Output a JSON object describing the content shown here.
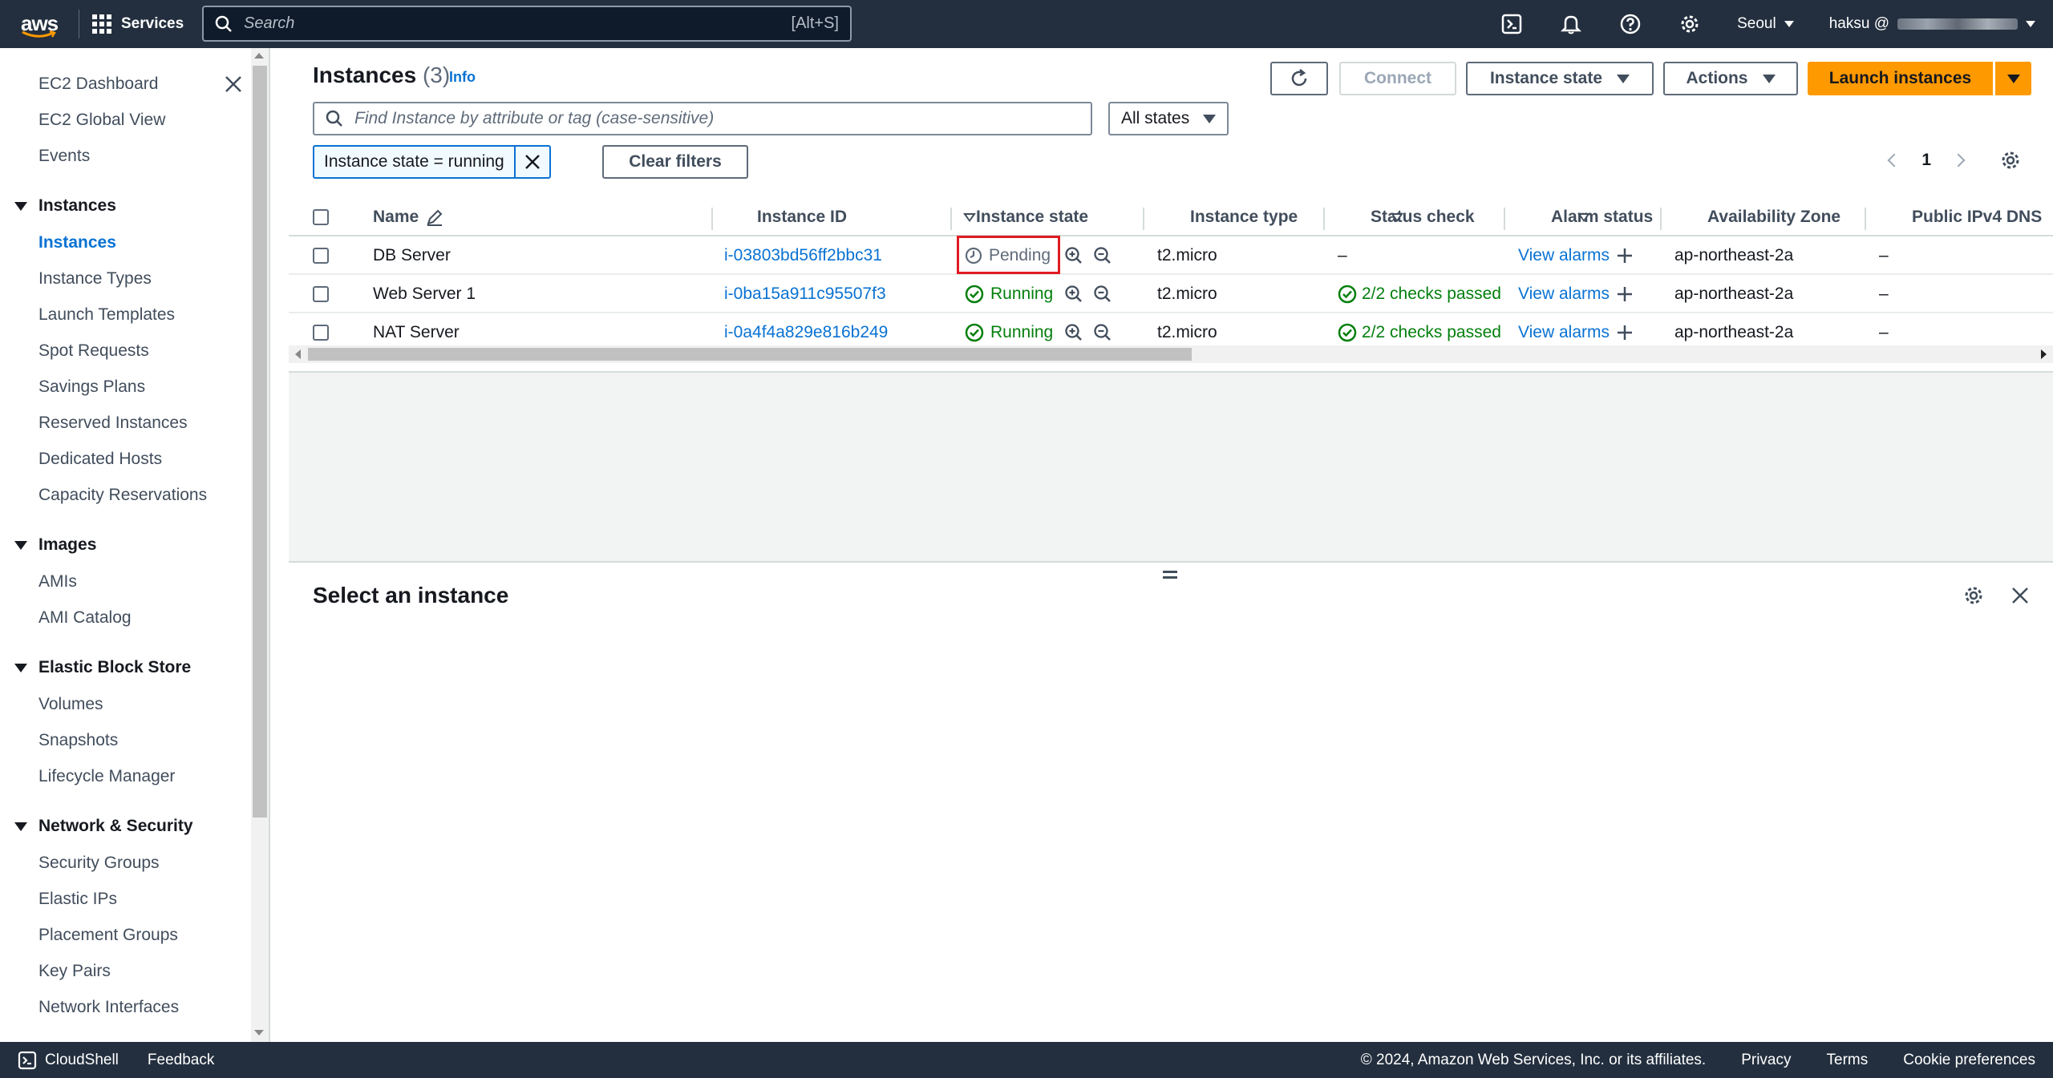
{
  "topnav": {
    "services_label": "Services",
    "search_placeholder": "Search",
    "search_shortcut": "[Alt+S]",
    "region": "Seoul",
    "account": "haksu @"
  },
  "sidebar": {
    "items_top": [
      "EC2 Dashboard",
      "EC2 Global View",
      "Events"
    ],
    "sections": [
      {
        "title": "Instances",
        "items": [
          "Instances",
          "Instance Types",
          "Launch Templates",
          "Spot Requests",
          "Savings Plans",
          "Reserved Instances",
          "Dedicated Hosts",
          "Capacity Reservations"
        ]
      },
      {
        "title": "Images",
        "items": [
          "AMIs",
          "AMI Catalog"
        ]
      },
      {
        "title": "Elastic Block Store",
        "items": [
          "Volumes",
          "Snapshots",
          "Lifecycle Manager"
        ]
      },
      {
        "title": "Network & Security",
        "items": [
          "Security Groups",
          "Elastic IPs",
          "Placement Groups",
          "Key Pairs",
          "Network Interfaces"
        ]
      }
    ],
    "active_item": "Instances"
  },
  "header": {
    "title": "Instances",
    "count": "(3)",
    "info": "Info",
    "connect": "Connect",
    "instance_state": "Instance state",
    "actions": "Actions",
    "launch": "Launch instances"
  },
  "filters": {
    "placeholder": "Find Instance by attribute or tag (case-sensitive)",
    "state_select": "All states",
    "token": "Instance state = running",
    "clear": "Clear filters",
    "page": "1"
  },
  "table": {
    "columns": [
      "Name",
      "Instance ID",
      "Instance state",
      "Instance type",
      "Status check",
      "Alarm status",
      "Availability Zone",
      "Public IPv4 DNS"
    ],
    "rows": [
      {
        "name": "DB Server",
        "id": "i-03803bd56ff2bbc31",
        "state": "Pending",
        "type": "t2.micro",
        "status": "–",
        "alarm": "View alarms",
        "az": "ap-northeast-2a",
        "dns": "–"
      },
      {
        "name": "Web Server 1",
        "id": "i-0ba15a911c95507f3",
        "state": "Running",
        "type": "t2.micro",
        "status": "2/2 checks passed",
        "alarm": "View alarms",
        "az": "ap-northeast-2a",
        "dns": "–"
      },
      {
        "name": "NAT Server",
        "id": "i-0a4f4a829e816b249",
        "state": "Running",
        "type": "t2.micro",
        "status": "2/2 checks passed",
        "alarm": "View alarms",
        "az": "ap-northeast-2a",
        "dns": "–"
      }
    ]
  },
  "detail": {
    "title": "Select an instance"
  },
  "footer": {
    "cloudshell": "CloudShell",
    "feedback": "Feedback",
    "copyright": "© 2024, Amazon Web Services, Inc. or its affiliates.",
    "privacy": "Privacy",
    "terms": "Terms",
    "cookies": "Cookie preferences"
  },
  "colors": {
    "nav_bg": "#232f3e",
    "link": "#0972d3",
    "primary": "#ff9900",
    "success": "#037f0c",
    "highlight": "#e01b22"
  }
}
